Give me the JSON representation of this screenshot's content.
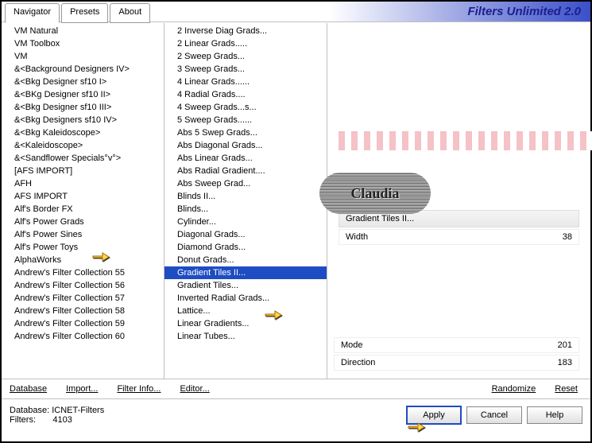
{
  "header": {
    "title": "Filters Unlimited 2.0",
    "tabs": [
      "Navigator",
      "Presets",
      "About"
    ],
    "active_tab": 0
  },
  "categories": [
    "VM Natural",
    "VM Toolbox",
    "VM",
    "&<Background Designers IV>",
    "&<Bkg Designer sf10 I>",
    "&<BKg Designer sf10 II>",
    "&<Bkg Designer sf10 III>",
    "&<Bkg Designers sf10 IV>",
    "&<Bkg Kaleidoscope>",
    "&<Kaleidoscope>",
    "&<Sandflower Specials°v°>",
    "[AFS IMPORT]",
    "AFH",
    "AFS IMPORT",
    "Alf's Border FX",
    "Alf's Power Grads",
    "Alf's Power Sines",
    "Alf's Power Toys",
    "AlphaWorks",
    "Andrew's Filter Collection 55",
    "Andrew's Filter Collection 56",
    "Andrew's Filter Collection 57",
    "Andrew's Filter Collection 58",
    "Andrew's Filter Collection 59",
    "Andrew's Filter Collection 60"
  ],
  "filters": [
    "2 Inverse Diag Grads...",
    "2 Linear Grads.....",
    "2 Sweep Grads...",
    "3 Sweep Grads...",
    "4 Linear Grads......",
    "4 Radial Grads....",
    "4 Sweep Grads...s...",
    "5 Sweep Grads......",
    "Abs 5 Swep Grads...",
    "Abs Diagonal Grads...",
    "Abs Linear Grads...",
    "Abs Radial Gradient....",
    "Abs Sweep Grad...",
    "Blinds II...",
    "Blinds...",
    "Cylinder...",
    "Diagonal Grads...",
    "Diamond Grads...",
    "Donut Grads...",
    "Gradient Tiles II...",
    "Gradient Tiles...",
    "Inverted Radial Grads...",
    "Lattice...",
    "Linear Gradients...",
    "Linear Tubes..."
  ],
  "selected_filter_index": 19,
  "preview": {
    "filter_name": "Gradient Tiles II...",
    "params": [
      {
        "label": "Width",
        "value": "38"
      }
    ],
    "bottom_params": [
      {
        "label": "Mode",
        "value": "201"
      },
      {
        "label": "Direction",
        "value": "183"
      }
    ]
  },
  "links": {
    "database": "Database",
    "import": "Import...",
    "filter_info": "Filter Info...",
    "editor": "Editor...",
    "randomize": "Randomize",
    "reset": "Reset"
  },
  "status": {
    "database_label": "Database:",
    "database_value": "ICNET-Filters",
    "filters_label": "Filters:",
    "filters_value": "4103"
  },
  "buttons": {
    "apply": "Apply",
    "cancel": "Cancel",
    "help": "Help"
  },
  "watermark": "Claudia"
}
